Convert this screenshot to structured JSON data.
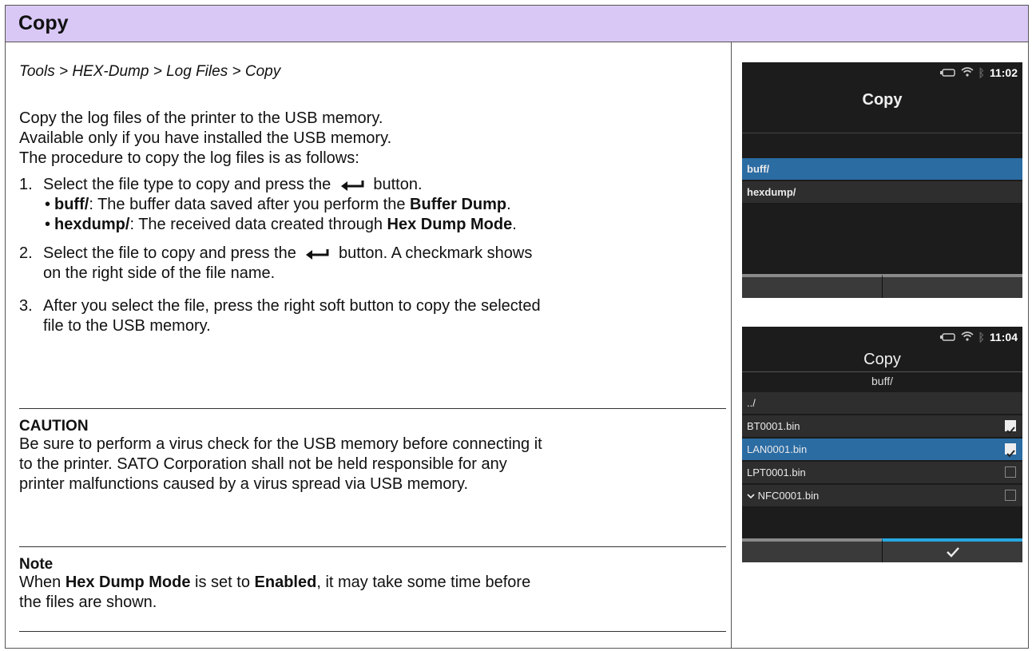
{
  "page": {
    "title": "Copy",
    "breadcrumb": "Tools > HEX-Dump > Log Files > Copy",
    "intro": [
      "Copy the log files of the printer to the USB memory.",
      "Available only if you have installed the USB memory.",
      "The procedure to copy the log files is as follows:"
    ],
    "step1": {
      "num": "1.",
      "text_before": "Select the file type to copy and press the",
      "text_after": "button.",
      "bullets": [
        {
          "bullet": "•",
          "bold": "buff/",
          "text": ": The buffer data saved after you perform the ",
          "bold2": "Buffer Dump",
          "end": "."
        },
        {
          "bullet": "•",
          "bold": "hexdump/",
          "text": ": The received data created through ",
          "bold2": "Hex Dump Mode",
          "end": "."
        }
      ]
    },
    "step2": {
      "num": "2.",
      "text_before": "Select the file to copy and press the",
      "text_after": "button. A checkmark shows",
      "line2": "on the right side of the file name."
    },
    "step3": {
      "num": "3.",
      "line1": "After you select the file, press the right soft button to copy the selected",
      "line2": "file to the USB memory."
    },
    "caution": {
      "heading": "CAUTION",
      "lines": [
        "Be sure to perform a virus check for the USB memory before connecting it",
        "to the printer. SATO Corporation shall not be held responsible for any",
        "printer malfunctions caused by a virus spread via USB memory."
      ]
    },
    "note": {
      "heading": "Note",
      "line1_a": "When ",
      "line1_b": "Hex Dump Mode",
      "line1_c": " is set to ",
      "line1_d": "Enabled",
      "line1_e": ", it may take some time before",
      "line2": "the files are shown."
    }
  },
  "screen1": {
    "time": "11:02",
    "title": "Copy",
    "items": [
      "buff/",
      "hexdump/"
    ]
  },
  "screen2": {
    "time": "11:04",
    "title": "Copy",
    "subtitle": "buff/",
    "items": [
      {
        "label": "../",
        "check": null
      },
      {
        "label": "BT0001.bin",
        "check": true
      },
      {
        "label": "LAN0001.bin",
        "check": true
      },
      {
        "label": "LPT0001.bin",
        "check": false
      },
      {
        "label": "NFC0001.bin",
        "check": false
      }
    ],
    "more_indicator": "✓"
  },
  "colors": {
    "title_bar": "#d9c8f5",
    "lcd_selected": "#2b6ca3",
    "softkey_active": "#27a8e0"
  }
}
